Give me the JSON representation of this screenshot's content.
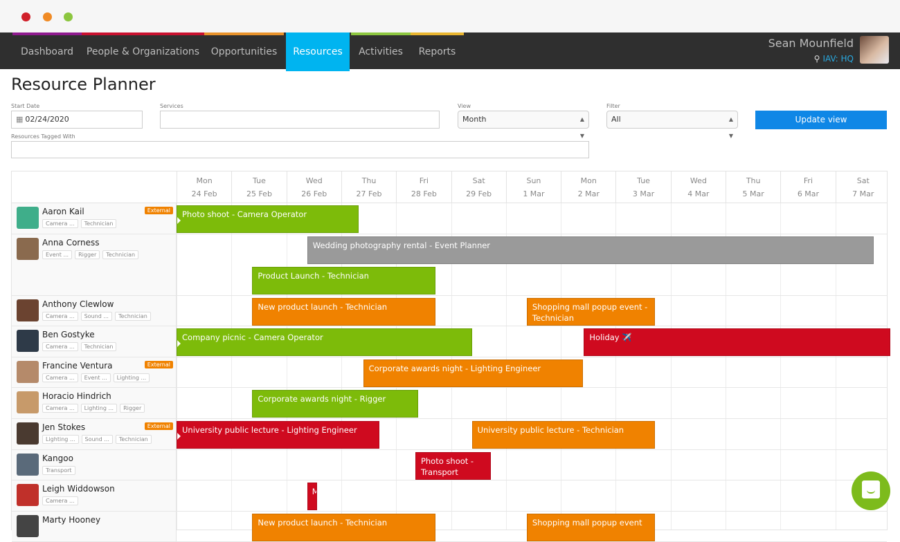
{
  "window": {
    "dots": [
      "#d0202a",
      "#f08a24",
      "#8cc63f"
    ]
  },
  "nav": {
    "items": [
      {
        "label": "Dashboard",
        "accent": "#8e1a8e",
        "active": false
      },
      {
        "label": "People & Organizations",
        "accent": "#c8102e",
        "active": false
      },
      {
        "label": "Opportunities",
        "accent": "#e8922a",
        "active": false
      },
      {
        "label": "Resources",
        "accent": "#00b4f0",
        "active": true
      },
      {
        "label": "Activities",
        "accent": "#8cc63f",
        "active": false
      },
      {
        "label": "Reports",
        "accent": "#e9b52f",
        "active": false
      }
    ],
    "user": {
      "name": "Sean Mounfield",
      "location": "IAV: HQ"
    }
  },
  "page": {
    "title": "Resource Planner"
  },
  "filters": {
    "start_date_label": "Start Date",
    "start_date_value": "02/24/2020",
    "services_label": "Services",
    "services_value": "",
    "view_label": "View",
    "view_value": "Month",
    "filter_label": "Filter",
    "filter_value": "All",
    "tagged_label": "Resources Tagged With",
    "tagged_value": "",
    "update_button": "Update view"
  },
  "planner": {
    "days": [
      {
        "dow": "Mon",
        "date": "24 Feb"
      },
      {
        "dow": "Tue",
        "date": "25 Feb"
      },
      {
        "dow": "Wed",
        "date": "26 Feb"
      },
      {
        "dow": "Thu",
        "date": "27 Feb"
      },
      {
        "dow": "Fri",
        "date": "28 Feb"
      },
      {
        "dow": "Sat",
        "date": "29 Feb"
      },
      {
        "dow": "Sun",
        "date": "1 Mar"
      },
      {
        "dow": "Mon",
        "date": "2 Mar"
      },
      {
        "dow": "Tue",
        "date": "3 Mar"
      },
      {
        "dow": "Wed",
        "date": "4 Mar"
      },
      {
        "dow": "Thu",
        "date": "5 Mar"
      },
      {
        "dow": "Fri",
        "date": "6 Mar"
      },
      {
        "dow": "Sat",
        "date": "7 Mar"
      }
    ],
    "colors": {
      "green": "#7dbb0a",
      "orange": "#f08200",
      "red": "#cf0a1f",
      "gray": "#9a9a9a",
      "external": "#f08200"
    },
    "resources": [
      {
        "name": "Aaron Kail",
        "external": true,
        "tags": [
          "Camera ...",
          "Technician"
        ],
        "avatar": "#3fae8a",
        "lanes": 1,
        "events": [
          {
            "title": "Photo shoot - Camera Operator",
            "start": 0,
            "end": 3.32,
            "lane": 0,
            "color": "green",
            "continues": true
          }
        ]
      },
      {
        "name": "Anna Corness",
        "external": false,
        "tags": [
          "Event ...",
          "Rigger",
          "Technician"
        ],
        "avatar": "#8a6a4e",
        "lanes": 2,
        "events": [
          {
            "title": "Wedding photography rental - Event Planner",
            "start": 2.38,
            "end": 12.7,
            "lane": 0,
            "color": "gray",
            "continues": false
          },
          {
            "title": "Product Launch - Technician",
            "start": 1.38,
            "end": 4.72,
            "lane": 1,
            "color": "green",
            "continues": false
          }
        ]
      },
      {
        "name": "Anthony Clewlow",
        "external": false,
        "tags": [
          "Camera ...",
          "Sound ...",
          "Technician"
        ],
        "avatar": "#6b4330",
        "lanes": 1,
        "events": [
          {
            "title": "New product launch - Technician",
            "start": 1.38,
            "end": 4.72,
            "lane": 0,
            "color": "orange",
            "continues": false
          },
          {
            "title": "Shopping mall popup event - Technician",
            "start": 6.38,
            "end": 8.72,
            "lane": 0,
            "color": "orange",
            "continues": false
          }
        ]
      },
      {
        "name": "Ben Gostyke",
        "external": false,
        "tags": [
          "Camera ...",
          "Technician"
        ],
        "avatar": "#2e3a48",
        "lanes": 1,
        "events": [
          {
            "title": "Company picnic - Camera Operator",
            "start": 0,
            "end": 5.38,
            "lane": 0,
            "color": "green",
            "continues": true
          },
          {
            "title": "Holiday ✈️",
            "start": 7.42,
            "end": 13,
            "lane": 0,
            "color": "red",
            "continues": false
          }
        ]
      },
      {
        "name": "Francine Ventura",
        "external": true,
        "tags": [
          "Camera ...",
          "Event ...",
          "Lighting ..."
        ],
        "avatar": "#b58a6a",
        "lanes": 1,
        "events": [
          {
            "title": "Corporate awards night - Lighting Engineer",
            "start": 3.4,
            "end": 7.4,
            "lane": 0,
            "color": "orange",
            "continues": false
          }
        ]
      },
      {
        "name": "Horacio Hindrich",
        "external": false,
        "tags": [
          "Camera ...",
          "Lighting ...",
          "Rigger"
        ],
        "avatar": "#c79a6a",
        "lanes": 1,
        "events": [
          {
            "title": "Corporate awards night - Rigger",
            "start": 1.38,
            "end": 4.4,
            "lane": 0,
            "color": "green",
            "continues": false
          }
        ]
      },
      {
        "name": "Jen Stokes",
        "external": true,
        "tags": [
          "Lighting ...",
          "Sound ...",
          "Technician"
        ],
        "avatar": "#4a3a30",
        "lanes": 1,
        "events": [
          {
            "title": "University public lecture - Lighting Engineer",
            "start": 0,
            "end": 3.7,
            "lane": 0,
            "color": "red",
            "continues": true
          },
          {
            "title": "University public lecture - Technician",
            "start": 5.38,
            "end": 8.72,
            "lane": 0,
            "color": "orange",
            "continues": false
          }
        ]
      },
      {
        "name": "Kangoo",
        "external": false,
        "tags": [
          "Transport"
        ],
        "avatar": "#5a6a7a",
        "lanes": 1,
        "events": [
          {
            "title": "Photo shoot - Transport",
            "start": 4.35,
            "end": 5.72,
            "lane": 0,
            "color": "red",
            "continues": false
          }
        ]
      },
      {
        "name": "Leigh Widdowson",
        "external": false,
        "tags": [
          "Camera ..."
        ],
        "avatar": "#c0302a",
        "lanes": 1,
        "events": [
          {
            "title": "Me",
            "start": 2.38,
            "end": 2.56,
            "lane": 0,
            "color": "red",
            "continues": false
          }
        ]
      },
      {
        "name": "Marty Hooney",
        "external": false,
        "tags": [],
        "avatar": "#444",
        "lanes": 1,
        "events": [
          {
            "title": "New product launch - Technician",
            "start": 1.38,
            "end": 4.72,
            "lane": 0,
            "color": "orange",
            "continues": false
          },
          {
            "title": "Shopping mall popup event",
            "start": 6.38,
            "end": 8.72,
            "lane": 0,
            "color": "orange",
            "continues": false
          }
        ]
      }
    ]
  }
}
